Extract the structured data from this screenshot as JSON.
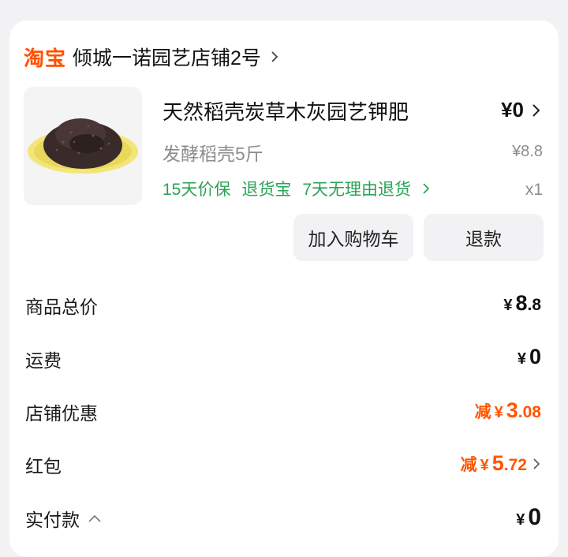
{
  "shop": {
    "platform": "淘宝",
    "name": "倾城一诺园艺店铺2号"
  },
  "product": {
    "title": "天然稻壳炭草木灰园艺钾肥",
    "spec": "发酵稻壳5斤",
    "tags": [
      "15天价保",
      "退货宝",
      "7天无理由退货"
    ],
    "price_symbol": "¥",
    "price": "0",
    "original_price": "¥8.8",
    "quantity": "x1",
    "thumbnail": "dark-granular-fertilizer-on-yellow-plate"
  },
  "actions": {
    "add_to_cart": "加入购物车",
    "refund": "退款"
  },
  "fees": {
    "subtotal": {
      "label": "商品总价",
      "symbol": "¥",
      "int": "8",
      "dec": ".8"
    },
    "shipping": {
      "label": "运费",
      "symbol": "¥",
      "int": "0"
    },
    "store_discount": {
      "label": "店铺优惠",
      "prefix": "减",
      "symbol": "¥",
      "int": "3",
      "dec": ".08"
    },
    "red_packet": {
      "label": "红包",
      "prefix": "减",
      "symbol": "¥",
      "int": "5",
      "dec": ".72"
    },
    "paid": {
      "label": "实付款",
      "symbol": "¥",
      "int": "0"
    }
  },
  "colors": {
    "brand": "#ff5000",
    "discount": "#ff5500",
    "tag_green": "#2aa356"
  }
}
